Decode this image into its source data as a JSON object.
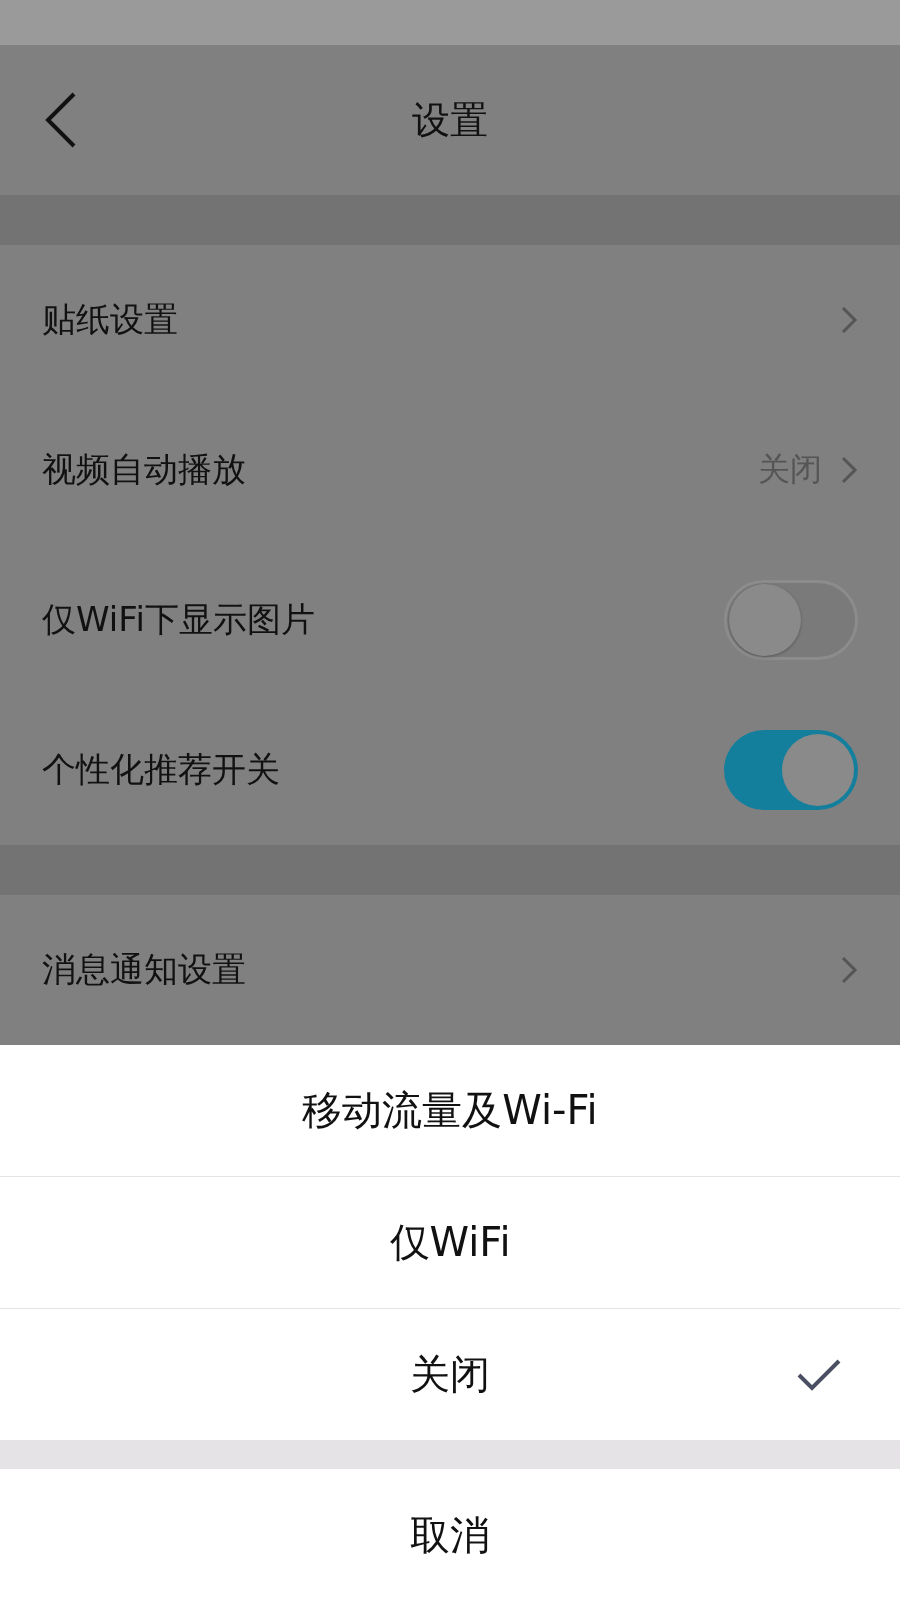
{
  "header": {
    "title": "设置"
  },
  "sections": [
    {
      "rows": [
        {
          "kind": "link",
          "label": "贴纸设置"
        },
        {
          "kind": "link",
          "label": "视频自动播放",
          "value": "关闭"
        },
        {
          "kind": "toggle",
          "label": "仅WiFi下显示图片",
          "on": false
        },
        {
          "kind": "toggle",
          "label": "个性化推荐开关",
          "on": true
        }
      ]
    },
    {
      "rows": [
        {
          "kind": "link",
          "label": "消息通知设置"
        }
      ]
    }
  ],
  "sheet": {
    "options": [
      {
        "label": "移动流量及Wi-Fi",
        "selected": false
      },
      {
        "label": "仅WiFi",
        "selected": false
      },
      {
        "label": "关闭",
        "selected": true
      }
    ],
    "cancel": "取消"
  }
}
